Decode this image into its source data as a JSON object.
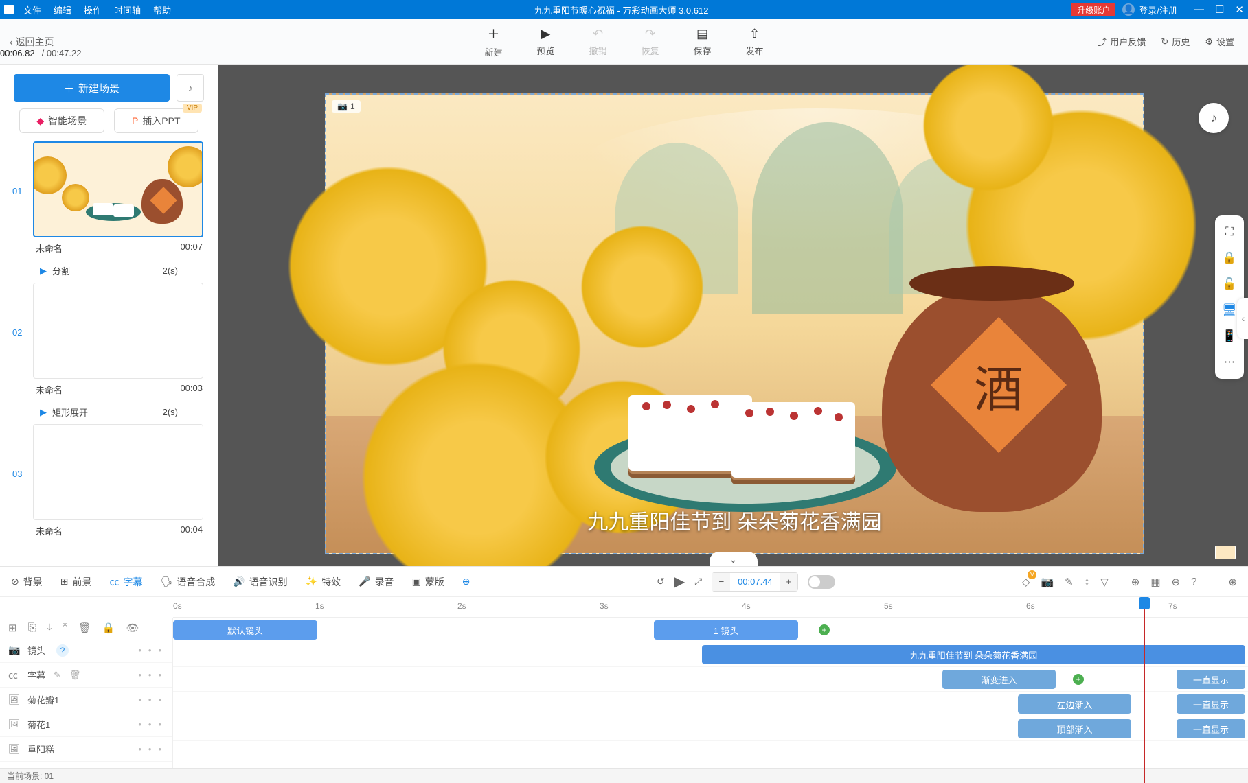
{
  "titlebar": {
    "menus": [
      "文件",
      "编辑",
      "操作",
      "时间轴",
      "帮助"
    ],
    "title": "九九重阳节暖心祝福 - 万彩动画大师 3.0.612",
    "upgrade": "升级账户",
    "auth": "登录/注册"
  },
  "top_toolbar": {
    "back": "返回主页",
    "buttons": [
      {
        "label": "新建",
        "icon": "＋"
      },
      {
        "label": "预览",
        "icon": "▶"
      },
      {
        "label": "撤销",
        "icon": "↶",
        "disabled": true
      },
      {
        "label": "恢复",
        "icon": "↷",
        "disabled": true
      },
      {
        "label": "保存",
        "icon": "▤"
      },
      {
        "label": "发布",
        "icon": "⇧"
      }
    ],
    "right": [
      {
        "label": "用户反馈",
        "icon": "⤴"
      },
      {
        "label": "历史",
        "icon": "↻"
      },
      {
        "label": "设置",
        "icon": "⚙"
      }
    ]
  },
  "sidebar": {
    "new_scene": "新建场景",
    "ai_scene": "智能场景",
    "insert_ppt": "插入PPT",
    "vip": "VIP",
    "scenes": [
      {
        "index": "01",
        "name": "未命名",
        "dur": "00:07",
        "transition": "分割",
        "tdur": "2(s)",
        "selected": true
      },
      {
        "index": "02",
        "name": "未命名",
        "dur": "00:03",
        "transition": "矩形展开",
        "tdur": "2(s)"
      },
      {
        "index": "03",
        "name": "未命名",
        "dur": "00:04"
      }
    ],
    "time_cur": "00:06.82",
    "time_total": "/ 00:47.22"
  },
  "canvas": {
    "camera_label": "1",
    "subtitle": "九九重阳佳节到 朵朵菊花香满园",
    "jar_char": "酒"
  },
  "timeline": {
    "tabs": [
      "背景",
      "前景",
      "字幕",
      "语音合成",
      "语音识别",
      "特效",
      "录音",
      "蒙版"
    ],
    "active_tab": 2,
    "time_value": "00:07.44",
    "ruler": [
      "0s",
      "1s",
      "2s",
      "3s",
      "4s",
      "5s",
      "6s",
      "7s"
    ],
    "tracks": {
      "camera": {
        "label": "镜头",
        "clips": [
          {
            "label": "默认镜头"
          },
          {
            "label": "1 镜头"
          }
        ]
      },
      "subtitle": {
        "label": "字幕",
        "clips": [
          {
            "label": "九九重阳佳节到 朵朵菊花香满园"
          }
        ]
      },
      "layers": [
        {
          "label": "菊花瓣1",
          "enter": "渐变进入",
          "stay": "一直显示"
        },
        {
          "label": "菊花1",
          "enter": "左边渐入",
          "stay": "一直显示"
        },
        {
          "label": "重阳糕",
          "enter": "顶部渐入",
          "stay": "一直显示"
        }
      ]
    },
    "status": "当前场景: 01"
  }
}
